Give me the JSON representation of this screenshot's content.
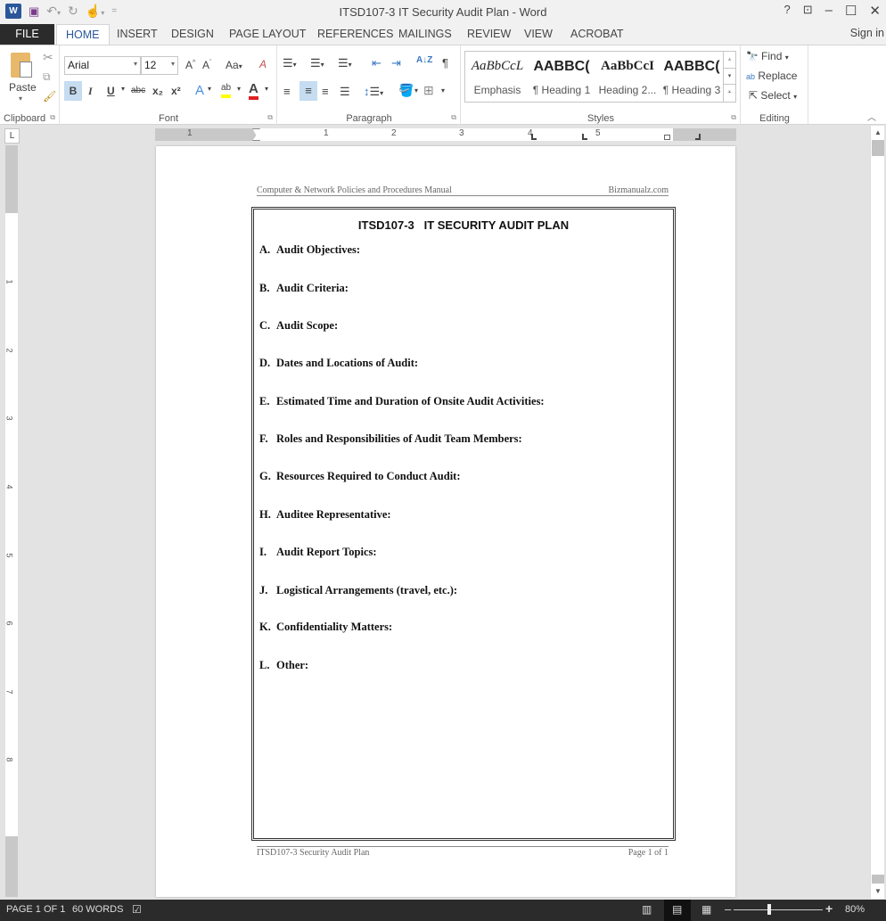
{
  "window": {
    "title": "ITSD107-3 IT Security Audit Plan - Word",
    "controls": {
      "help": "?",
      "ribbon_display": "⊡",
      "minimize": "–",
      "maximize": "☐",
      "close": "✕"
    }
  },
  "qat": {
    "app_icon": "W",
    "save_icon": "💾",
    "undo_icon": "↶",
    "redo_icon": "↻",
    "touch_icon": "☝",
    "customize": "⩧"
  },
  "tabs": [
    {
      "label": "FILE"
    },
    {
      "label": "HOME",
      "active": true
    },
    {
      "label": "INSERT"
    },
    {
      "label": "DESIGN"
    },
    {
      "label": "PAGE LAYOUT"
    },
    {
      "label": "REFERENCES"
    },
    {
      "label": "MAILINGS"
    },
    {
      "label": "REVIEW"
    },
    {
      "label": "VIEW"
    },
    {
      "label": "ACROBAT"
    }
  ],
  "signin": "Sign in",
  "ribbon": {
    "clipboard": {
      "label": "Clipboard",
      "paste": "Paste"
    },
    "font": {
      "label": "Font",
      "font_name": "Arial",
      "font_size": "12",
      "grow": "A˄",
      "shrink": "A˅",
      "change_case": "Aa",
      "clear_format": "A",
      "bold": "B",
      "italic": "I",
      "underline": "U",
      "strikethrough": "abc",
      "subscript": "x₂",
      "superscript": "x²",
      "text_effects": "A",
      "highlight": "ab",
      "font_color": "A"
    },
    "paragraph": {
      "label": "Paragraph",
      "sort": "A↓Z",
      "pilcrow": "¶"
    },
    "styles": {
      "label": "Styles",
      "items": [
        {
          "sample": "AaBbCcL",
          "name": "Emphasis"
        },
        {
          "sample": "AABBC(",
          "name": "¶ Heading 1"
        },
        {
          "sample": "AaBbCcI",
          "name": "Heading 2..."
        },
        {
          "sample": "AABBC(",
          "name": "¶ Heading 3"
        }
      ]
    },
    "editing": {
      "label": "Editing",
      "find": "Find",
      "replace": "Replace",
      "select": "Select"
    }
  },
  "ruler": {
    "corner": "L",
    "h_numbers": [
      "1",
      "1",
      "2",
      "3",
      "4",
      "5"
    ],
    "v_numbers": [
      "1",
      "2",
      "3",
      "4",
      "5",
      "6",
      "7",
      "8"
    ]
  },
  "document": {
    "header_left": "Computer & Network Policies and Procedures Manual",
    "header_right": "Bizmanualz.com",
    "title": "ITSD107-3   IT SECURITY AUDIT PLAN",
    "sections": [
      {
        "letter": "A.",
        "text": "Audit Objectives:"
      },
      {
        "letter": "B.",
        "text": "Audit Criteria:"
      },
      {
        "letter": "C.",
        "text": "Audit Scope:"
      },
      {
        "letter": "D.",
        "text": "Dates and Locations of Audit:"
      },
      {
        "letter": "E.",
        "text": "Estimated Time and Duration of Onsite Audit Activities:"
      },
      {
        "letter": "F.",
        "text": "Roles and Responsibilities of Audit Team Members:"
      },
      {
        "letter": "G.",
        "text": "Resources Required to Conduct Audit:"
      },
      {
        "letter": "H.",
        "text": "Auditee Representative:"
      },
      {
        "letter": "I.",
        "text": "Audit Report Topics:"
      },
      {
        "letter": "J.",
        "text": "Logistical Arrangements (travel, etc.):"
      },
      {
        "letter": "K.",
        "text": "Confidentiality Matters:"
      },
      {
        "letter": "L.",
        "text": "Other:"
      }
    ],
    "footer_left": "ITSD107-3 Security Audit Plan",
    "footer_right": "Page 1 of 1"
  },
  "statusbar": {
    "page": "PAGE 1 OF 1",
    "words": "60 WORDS",
    "proofing_icon": "📖",
    "zoom_minus": "–",
    "zoom_plus": "+",
    "zoom_level": "80%",
    "zoom_percent": 80
  }
}
